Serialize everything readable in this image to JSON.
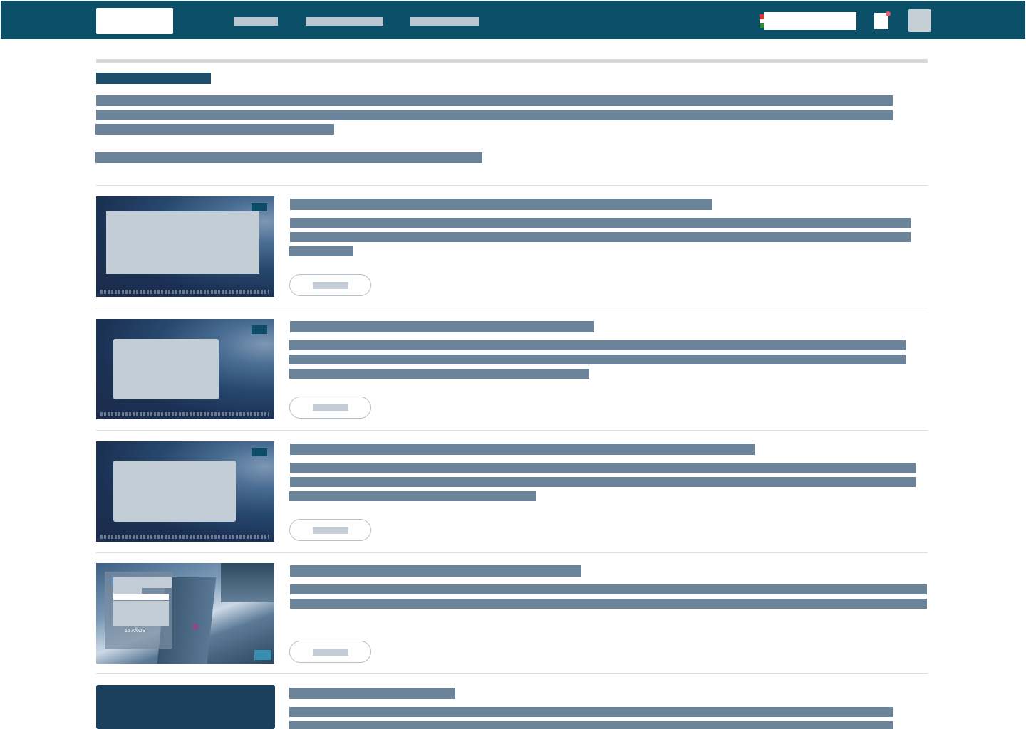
{
  "header": {
    "logo": "",
    "nav": [
      "",
      "",
      ""
    ],
    "language": "",
    "cart_badge": ""
  },
  "page": {
    "title": "",
    "intro": [
      "",
      "",
      "",
      ""
    ]
  },
  "cards": [
    {
      "title": "",
      "description": [
        "",
        "",
        ""
      ],
      "more_label": "",
      "thumb": "space"
    },
    {
      "title": "",
      "description": [
        "",
        "",
        ""
      ],
      "more_label": "",
      "thumb": "space"
    },
    {
      "title": "",
      "description": [
        "",
        "",
        ""
      ],
      "more_label": "",
      "thumb": "space"
    },
    {
      "title": "",
      "description": [
        "",
        ""
      ],
      "more_label": "",
      "thumb": "city",
      "thumb_text": "15 AÑOS"
    },
    {
      "title": "",
      "description": [
        "",
        ""
      ],
      "more_label": "",
      "thumb": "dark"
    }
  ],
  "colors": {
    "header_bg": "#0c4f69",
    "text_placeholder": "#6b8499",
    "title_dark": "#1f4e6b",
    "cart_dot": "#e85a78"
  },
  "icons": {
    "cart": "shopping-cart-icon",
    "avatar": "user-avatar-icon",
    "flag": "flag-icon"
  }
}
